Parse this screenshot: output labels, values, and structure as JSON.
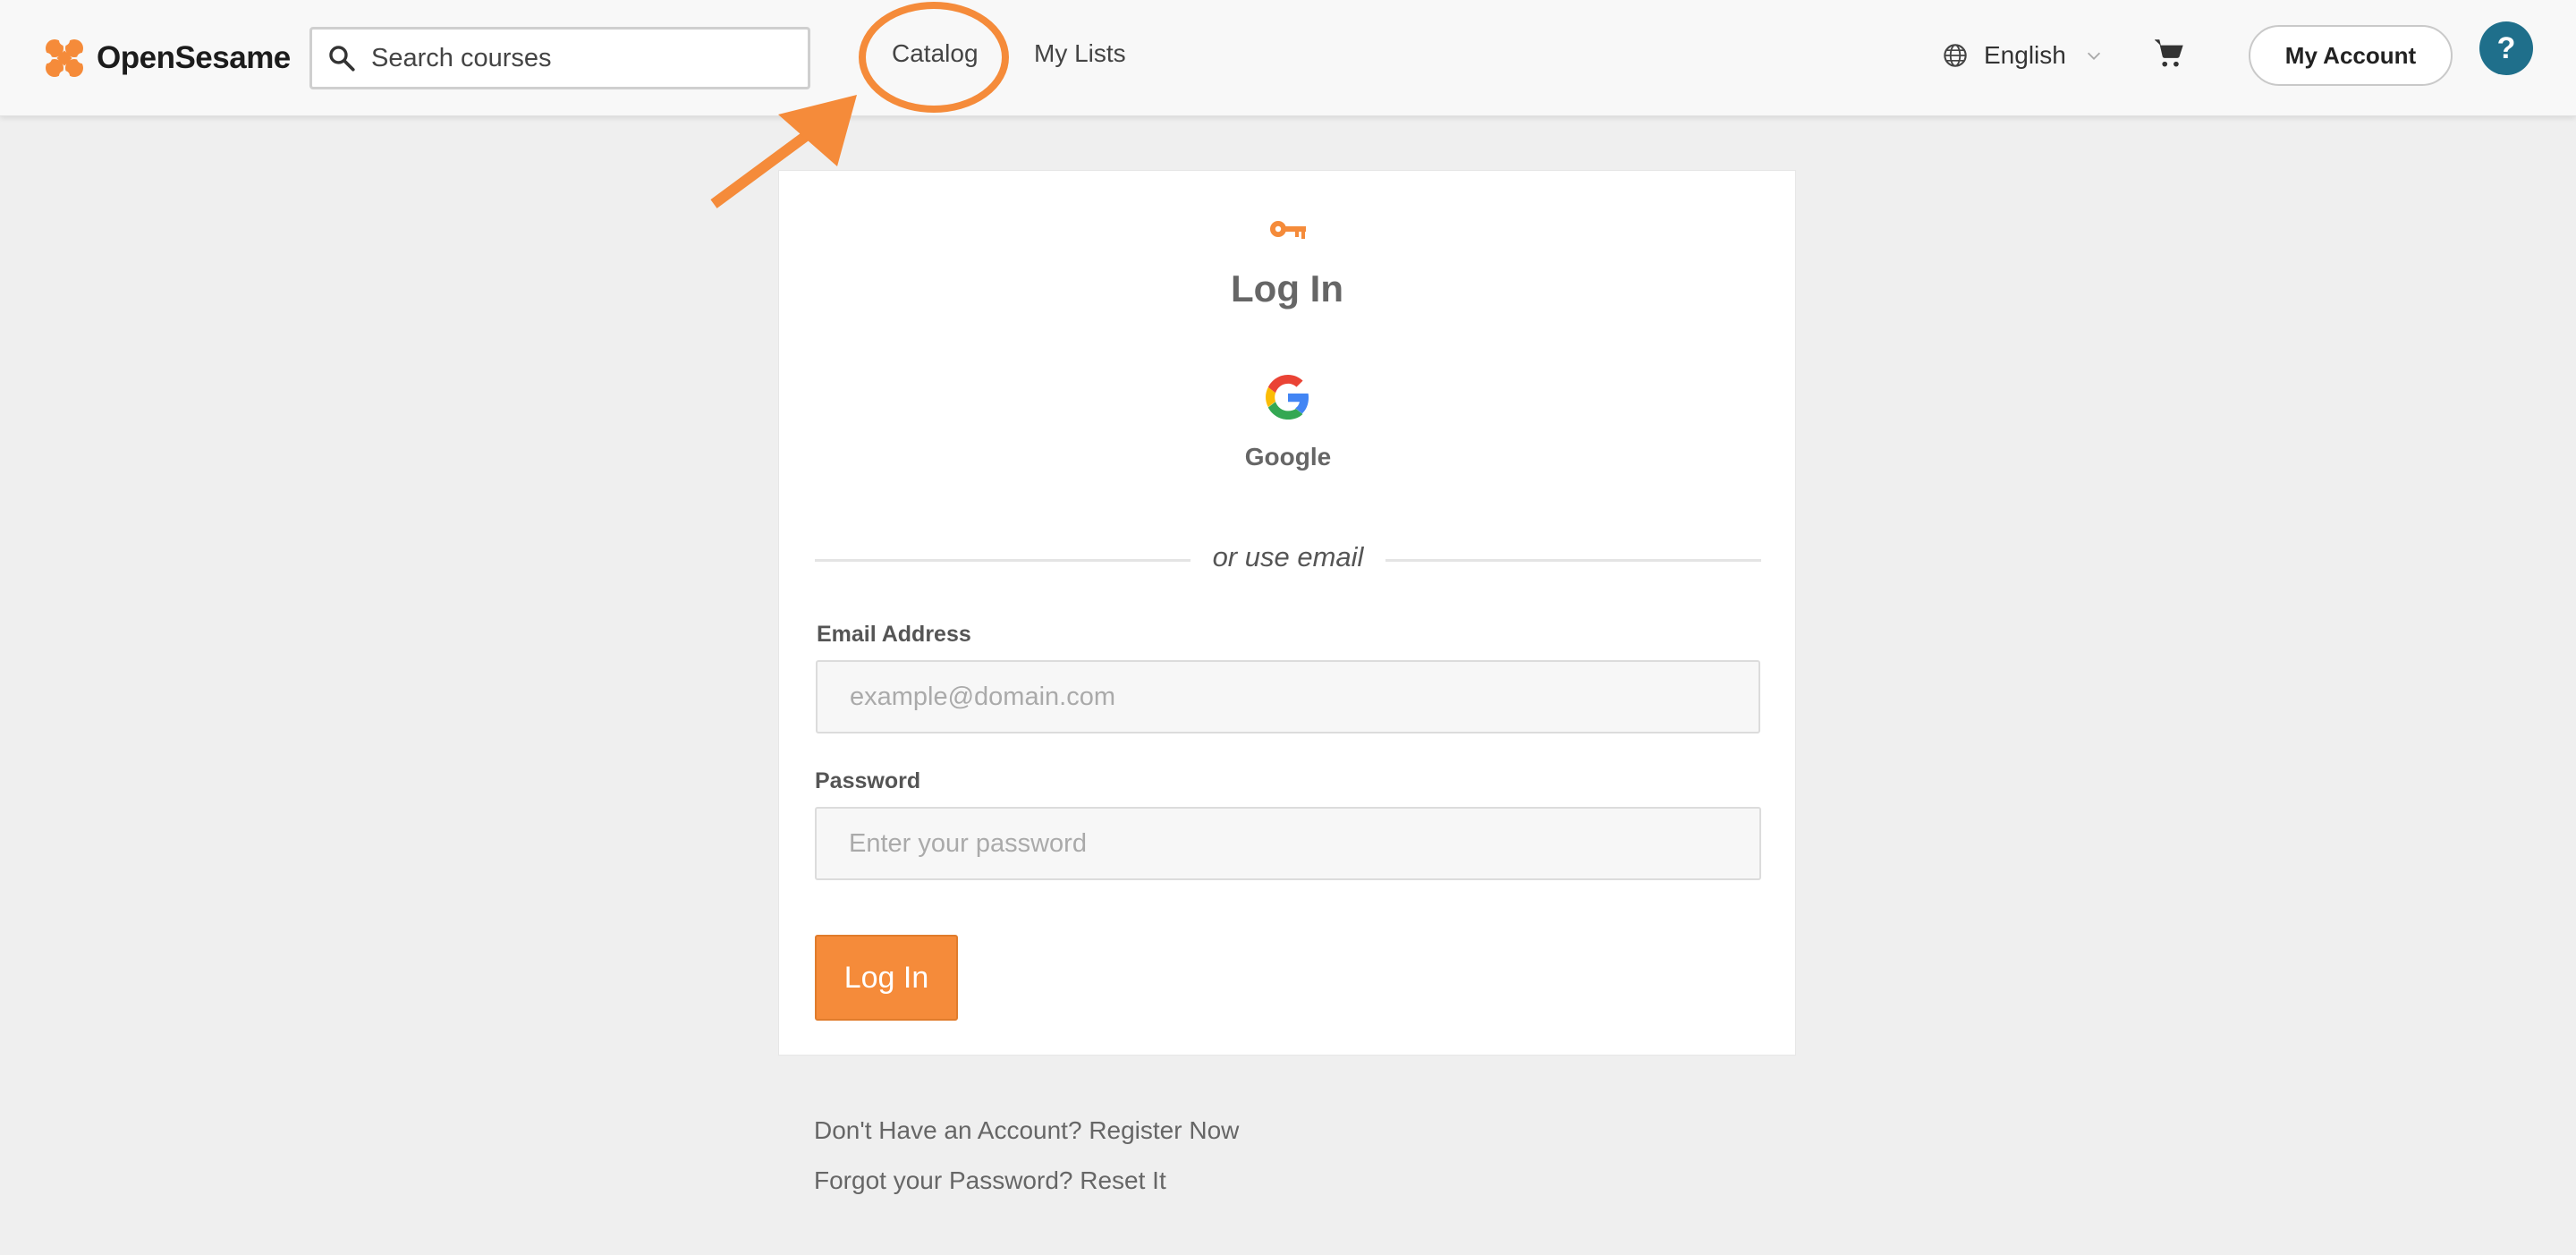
{
  "header": {
    "brand": "OpenSesame",
    "search": {
      "placeholder": "Search courses"
    },
    "nav": {
      "catalog": "Catalog",
      "my_lists": "My Lists"
    },
    "language": "English",
    "my_account": "My Account",
    "help": "?"
  },
  "login": {
    "title": "Log In",
    "google_label": "Google",
    "divider_text": "or use email",
    "email_label": "Email Address",
    "email_placeholder": "example@domain.com",
    "password_label": "Password",
    "password_placeholder": "Enter your password",
    "submit_label": "Log In"
  },
  "footer": {
    "register": "Don't Have an Account? Register Now",
    "reset": "Forgot your Password? Reset It"
  },
  "colors": {
    "accent": "#f58b3a",
    "help_button": "#1f6f8b",
    "annotation": "#f58b3a"
  },
  "icons": [
    "logo-icon",
    "search-icon",
    "globe-icon",
    "chevron-down-icon",
    "cart-icon",
    "key-icon",
    "google-icon"
  ]
}
